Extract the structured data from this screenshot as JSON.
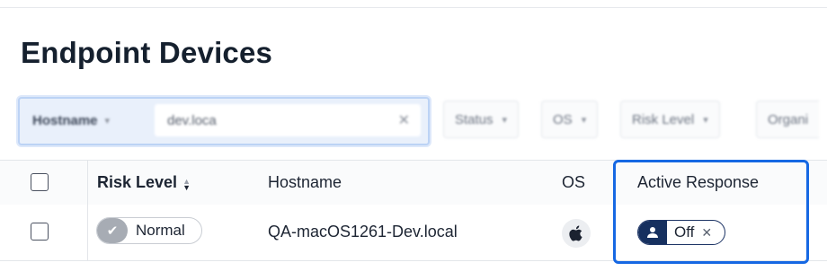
{
  "page": {
    "title": "Endpoint Devices"
  },
  "filters": {
    "field_label": "Hostname",
    "search_value": "dev.loca",
    "clear_label": "✕",
    "chips": [
      {
        "label": "Status"
      },
      {
        "label": "OS"
      },
      {
        "label": "Risk Level"
      },
      {
        "label": "Organi"
      }
    ]
  },
  "table": {
    "headers": {
      "risk_level": "Risk Level",
      "hostname": "Hostname",
      "os": "OS",
      "active_response": "Active Response"
    },
    "rows": [
      {
        "risk_level": "Normal",
        "hostname": "QA-macOS1261-Dev.local",
        "os_icon": "apple-icon",
        "active_response": "Off"
      }
    ]
  },
  "colors": {
    "highlight": "#1668e3",
    "active_response_pill": "#16305f",
    "risk_knob": "#a7acb4"
  }
}
